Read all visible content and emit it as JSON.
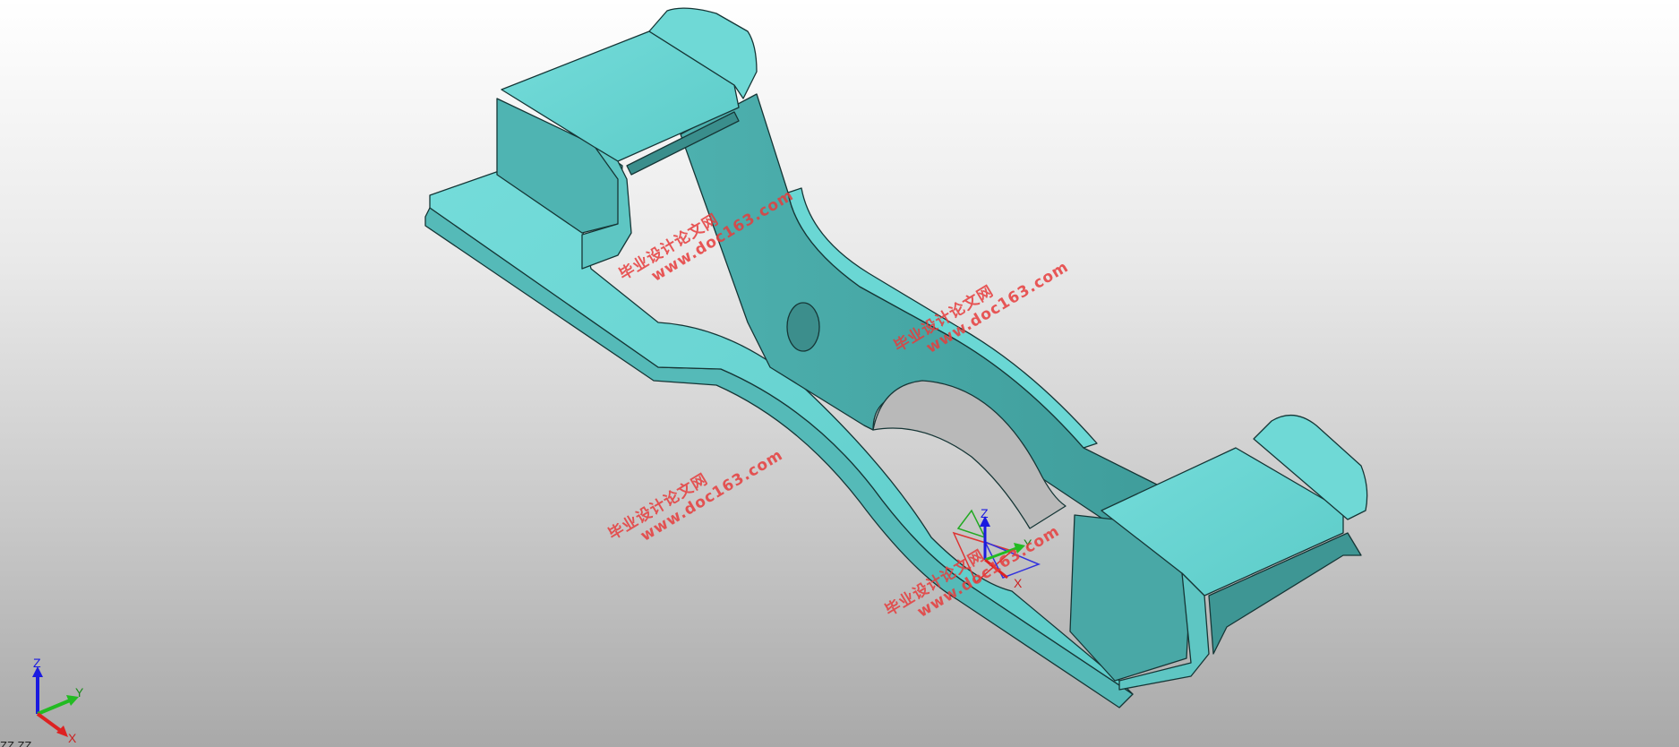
{
  "viewport": {
    "background_top": "#ffffff",
    "background_bottom": "#a9a9a9",
    "model_color": "#5fc9c6",
    "model_dark_color": "#3e9a98",
    "edge_color": "#1a3a3a"
  },
  "watermarks": [
    {
      "line1": "毕业设计论文网",
      "line2": "www.doc163.com"
    },
    {
      "line1": "毕业设计论文网",
      "line2": "www.doc163.com"
    },
    {
      "line1": "毕业设计论文网",
      "line2": "www.doc163.com"
    },
    {
      "line1": "毕业设计论文网",
      "line2": "www.doc163.com"
    }
  ],
  "part_triad": {
    "z": "Z",
    "y": "Y",
    "x": "X"
  },
  "view_triad": {
    "z": "Z",
    "y": "Y",
    "x": "X"
  },
  "status_text": "ZZ.ZZ"
}
